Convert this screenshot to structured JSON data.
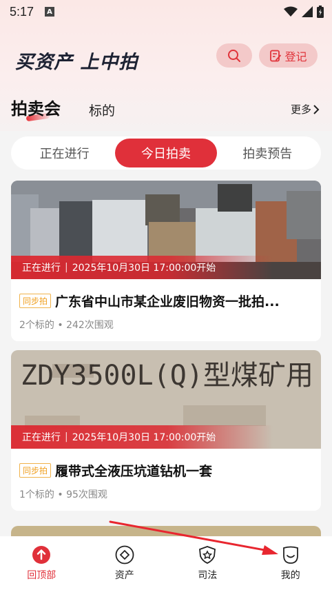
{
  "status_bar": {
    "time": "5:17",
    "indicator": "A"
  },
  "header": {
    "logo": "买资产 上中拍",
    "register_label": "登记"
  },
  "section_tabs": {
    "active": "拍卖会",
    "inactive": "标的",
    "more": "更多"
  },
  "filter_tabs": [
    "正在进行",
    "今日拍卖",
    "拍卖预告"
  ],
  "filter_active_index": 1,
  "auctions": [
    {
      "status": "正在进行",
      "time": "2025年10月30日 17:00:00开始",
      "badge": "同步拍",
      "title": "广东省中山市某企业废旧物资一批拍...",
      "meta": "2个标的 • 242次围观"
    },
    {
      "status": "正在进行",
      "time": "2025年10月30日 17:00:00开始",
      "badge": "同步拍",
      "title": "履带式全液压坑道钻机一套",
      "meta": "1个标的 • 95次围观",
      "image_text": "ZDY3500L(Q)型煤矿用"
    }
  ],
  "bottom_nav": [
    {
      "label": "回顶部",
      "icon": "arrow-up-icon"
    },
    {
      "label": "资产",
      "icon": "diamond-icon"
    },
    {
      "label": "司法",
      "icon": "shield-star-icon"
    },
    {
      "label": "我的",
      "icon": "user-face-icon"
    }
  ],
  "colors": {
    "accent": "#e0303a",
    "badge": "#f0a020"
  }
}
